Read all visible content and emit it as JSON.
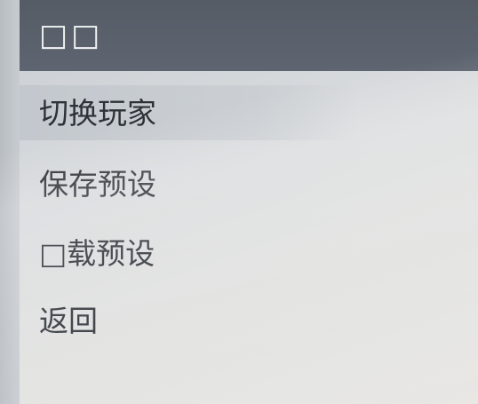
{
  "menu": {
    "title": "□□",
    "items": [
      {
        "label": "切换玩家",
        "selected": true
      },
      {
        "label": "保存预设",
        "selected": false
      },
      {
        "label": "□载预设",
        "selected": false
      },
      {
        "label": "返回",
        "selected": false
      }
    ]
  },
  "colors": {
    "header_bg": "#5a616b",
    "header_text": "#f2f3f4",
    "item_text": "#2e3238",
    "selected_bg": "#c6cbd0",
    "page_bg": "#dcdedd"
  }
}
